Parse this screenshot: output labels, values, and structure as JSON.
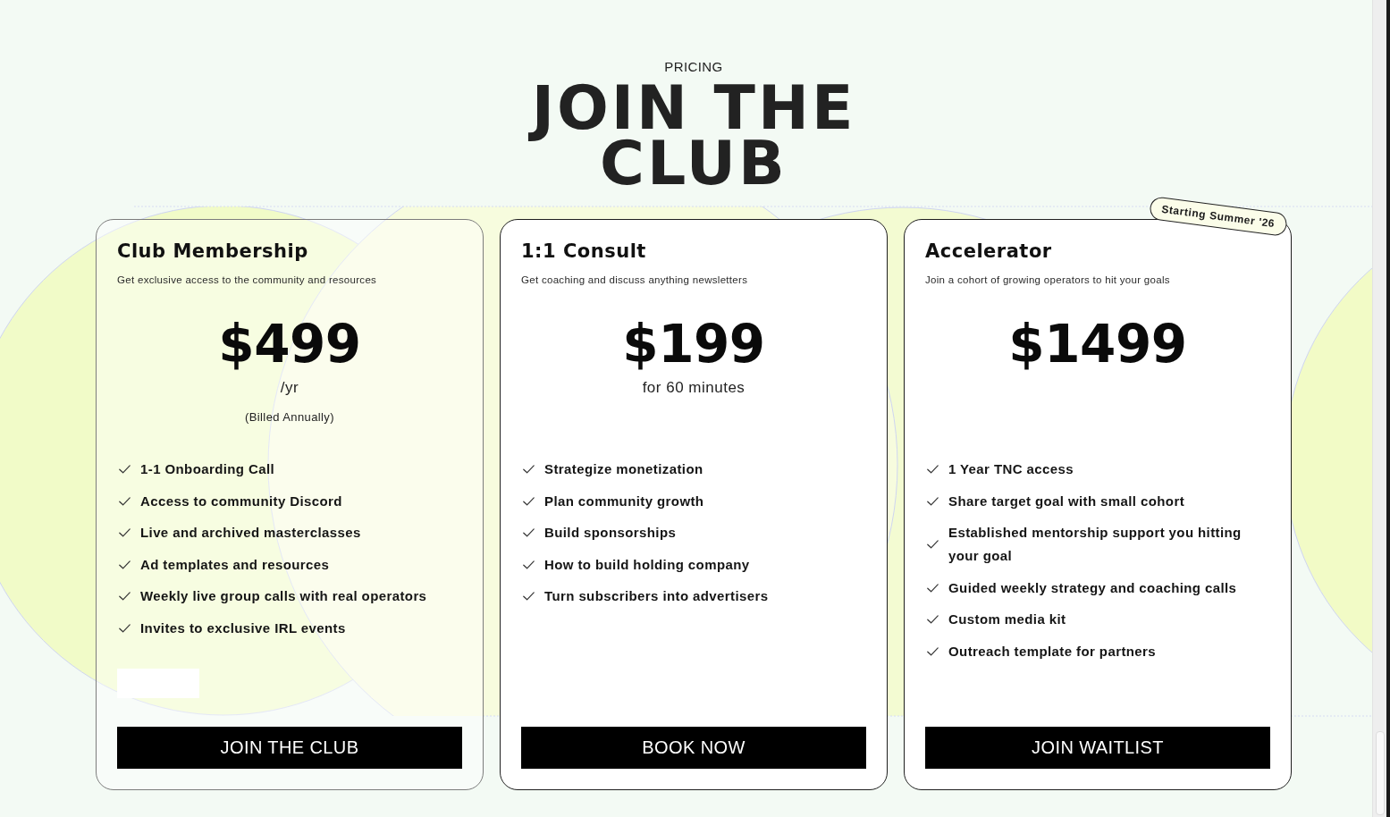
{
  "header": {
    "eyebrow": "PRICING",
    "title": "JOIN THE CLUB"
  },
  "plans": [
    {
      "name": "Club Membership",
      "description": "Get exclusive access to the community and resources",
      "price": "$499",
      "price_note": "/yr",
      "billing_note": "(Billed Annually)",
      "features": [
        "1-1 Onboarding Call",
        "Access to community Discord",
        "Live and archived masterclasses",
        "Ad templates and resources",
        "Weekly live group calls with real operators",
        "Invites to exclusive IRL events"
      ],
      "blank_block": true,
      "button": "JOIN THE CLUB"
    },
    {
      "name": "1:1 Consult",
      "description": "Get coaching and discuss anything newsletters",
      "price": "$199",
      "price_note": "for 60 minutes",
      "features": [
        "Strategize monetization",
        "Plan community growth",
        "Build sponsorships",
        "How to build holding company",
        "Turn subscribers into advertisers"
      ],
      "button": "BOOK NOW"
    },
    {
      "name": "Accelerator",
      "badge": "Starting Summer '26",
      "description": "Join a cohort of growing operators to hit your goals",
      "price": "$1499",
      "features": [
        "1 Year TNC access",
        "Share target goal with small cohort",
        "Established mentorship support you hitting your goal",
        "Guided weekly strategy and coaching calls",
        "Custom media kit",
        "Outreach template for partners"
      ],
      "button": "JOIN WAITLIST"
    }
  ]
}
